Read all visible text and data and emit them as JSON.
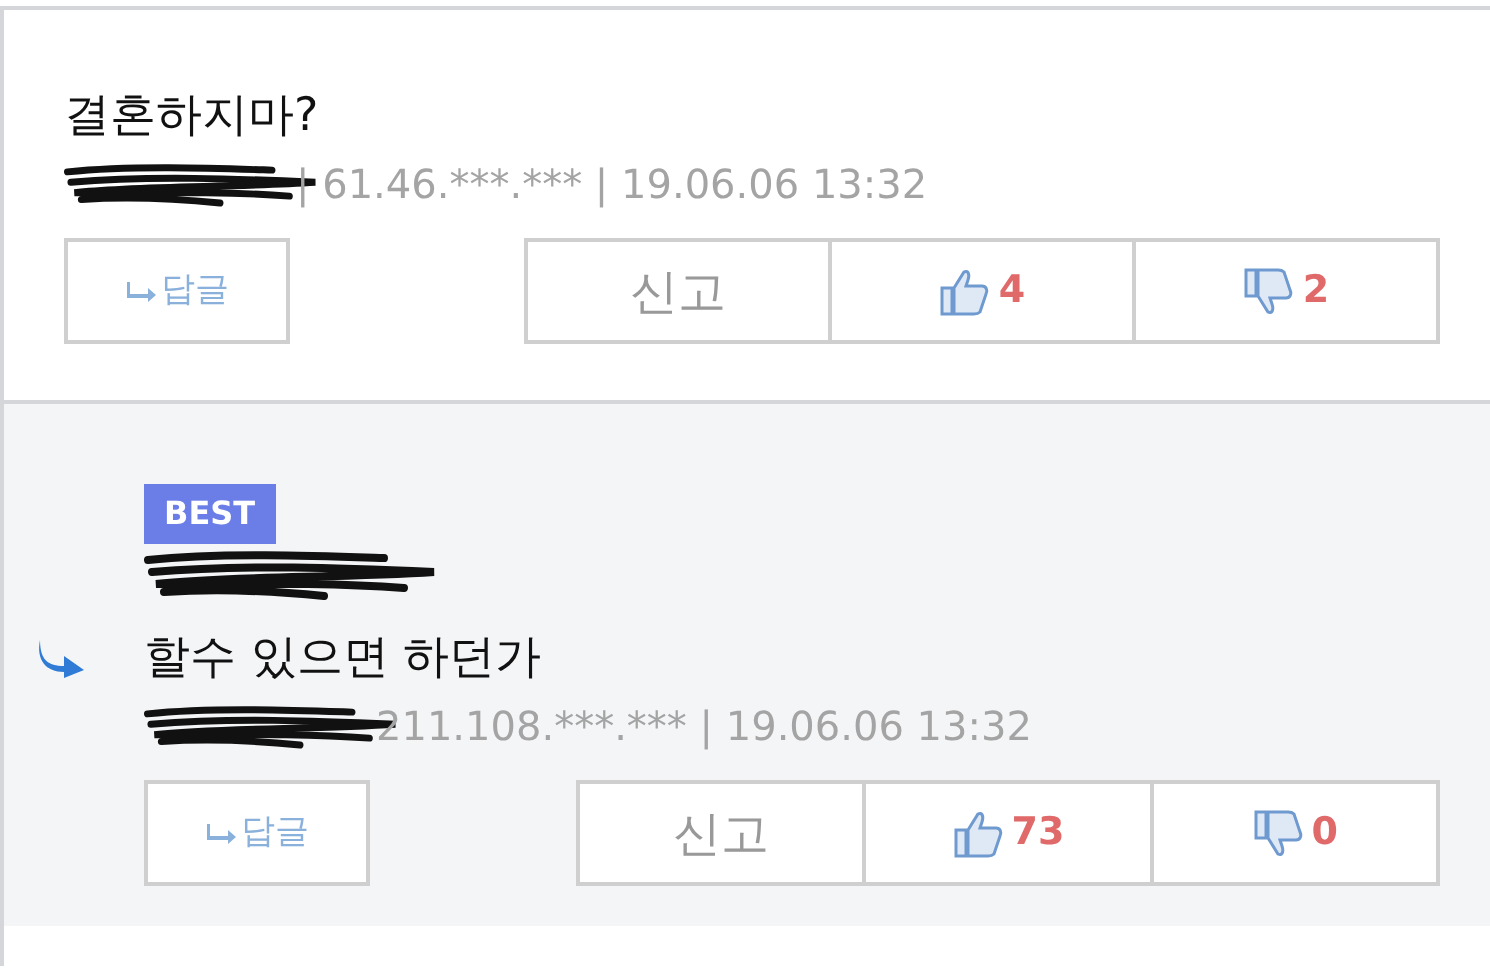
{
  "comments": [
    {
      "best": false,
      "is_reply": false,
      "text": "결혼하지마?",
      "meta": "| 61.46.***.*** | 19.06.06 13:32",
      "reply_label": "답글",
      "report_label": "신고",
      "likes": "4",
      "dislikes": "2"
    },
    {
      "best": true,
      "best_label": "BEST",
      "is_reply": true,
      "text": "할수 있으면 하던가",
      "meta": "211.108.***.*** | 19.06.06 13:32",
      "reply_label": "답글",
      "report_label": "신고",
      "likes": "73",
      "dislikes": "0"
    }
  ]
}
